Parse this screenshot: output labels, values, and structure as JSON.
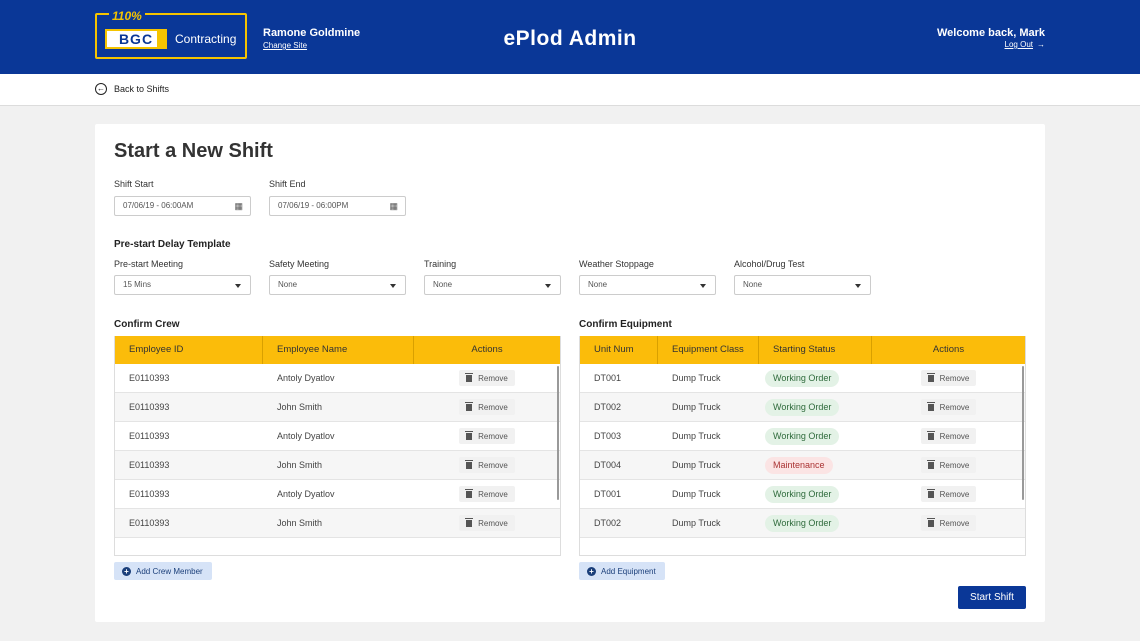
{
  "header": {
    "logo_pct": "110%",
    "logo_bgc": "BGC",
    "logo_text": "Contracting",
    "site_name": "Ramone Goldmine",
    "change_site": "Change Site",
    "app_title": "ePlod Admin",
    "welcome": "Welcome back, Mark",
    "logout": "Log Out"
  },
  "subbar": {
    "back_label": "Back to Shifts"
  },
  "form": {
    "title": "Start a New Shift",
    "shift_start_label": "Shift Start",
    "shift_start_value": "07/06/19 - 06:00AM",
    "shift_end_label": "Shift End",
    "shift_end_value": "07/06/19 - 06:00PM",
    "prestart_title": "Pre-start Delay Template",
    "delays": [
      {
        "label": "Pre-start Meeting",
        "value": "15 Mins"
      },
      {
        "label": "Safety Meeting",
        "value": "None"
      },
      {
        "label": "Training",
        "value": "None"
      },
      {
        "label": "Weather Stoppage",
        "value": "None"
      },
      {
        "label": "Alcohol/Drug Test",
        "value": "None"
      }
    ]
  },
  "crew": {
    "title": "Confirm Crew",
    "headers": [
      "Employee ID",
      "Employee Name",
      "Actions"
    ],
    "rows": [
      {
        "id": "E0110393",
        "name": "Antoly Dyatlov",
        "action": "Remove"
      },
      {
        "id": "E0110393",
        "name": "John Smith",
        "action": "Remove"
      },
      {
        "id": "E0110393",
        "name": "Antoly Dyatlov",
        "action": "Remove"
      },
      {
        "id": "E0110393",
        "name": "John Smith",
        "action": "Remove"
      },
      {
        "id": "E0110393",
        "name": "Antoly Dyatlov",
        "action": "Remove"
      },
      {
        "id": "E0110393",
        "name": "John Smith",
        "action": "Remove"
      }
    ],
    "add_label": "Add Crew Member"
  },
  "equipment": {
    "title": "Confirm Equipment",
    "headers": [
      "Unit Num",
      "Equipment Class",
      "Starting Status",
      "Actions"
    ],
    "rows": [
      {
        "unit": "DT001",
        "class": "Dump Truck",
        "status": "Working Order",
        "action": "Remove"
      },
      {
        "unit": "DT002",
        "class": "Dump Truck",
        "status": "Working Order",
        "action": "Remove"
      },
      {
        "unit": "DT003",
        "class": "Dump Truck",
        "status": "Working Order",
        "action": "Remove"
      },
      {
        "unit": "DT004",
        "class": "Dump Truck",
        "status": "Maintenance",
        "action": "Remove"
      },
      {
        "unit": "DT001",
        "class": "Dump Truck",
        "status": "Working Order",
        "action": "Remove"
      },
      {
        "unit": "DT002",
        "class": "Dump Truck",
        "status": "Working Order",
        "action": "Remove"
      }
    ],
    "add_label": "Add Equipment"
  },
  "actions": {
    "start_shift": "Start Shift"
  },
  "colors": {
    "brand_blue": "#0a3797",
    "header_yellow": "#fbbc0a",
    "ok_green": "#e3f2e6",
    "maint_red": "#fbe4e4"
  }
}
